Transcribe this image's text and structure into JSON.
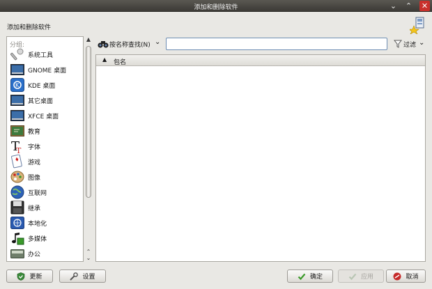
{
  "window": {
    "title": "添加和删除软件"
  },
  "header": {
    "label": "添加和删除软件"
  },
  "sidebar": {
    "group_label": "分组:",
    "items": [
      {
        "label": "系统工具",
        "icon": "system-tools-icon"
      },
      {
        "label": "GNOME 桌面",
        "icon": "gnome-desktop-icon"
      },
      {
        "label": "KDE 桌面",
        "icon": "kde-desktop-icon"
      },
      {
        "label": "其它桌面",
        "icon": "other-desktops-icon"
      },
      {
        "label": "XFCE 桌面",
        "icon": "xfce-desktop-icon"
      },
      {
        "label": "教育",
        "icon": "education-icon"
      },
      {
        "label": "字体",
        "icon": "fonts-icon"
      },
      {
        "label": "游戏",
        "icon": "games-icon"
      },
      {
        "label": "图像",
        "icon": "graphics-icon"
      },
      {
        "label": "互联网",
        "icon": "internet-icon"
      },
      {
        "label": "继承",
        "icon": "legacy-icon"
      },
      {
        "label": "本地化",
        "icon": "localization-icon"
      },
      {
        "label": "多媒体",
        "icon": "multimedia-icon"
      },
      {
        "label": "办公",
        "icon": "office-icon"
      }
    ]
  },
  "search": {
    "mode_label": "按名称查找(N)",
    "value": "",
    "filter_label": "过滤"
  },
  "package_list": {
    "column_header": "包名",
    "rows": []
  },
  "buttons": {
    "update": "更新",
    "settings": "设置",
    "ok": "确定",
    "apply": "应用",
    "cancel": "取消"
  },
  "colors": {
    "titlebar": "#4a4844",
    "close": "#c9302c",
    "ok_green": "#3a9a2a",
    "cancel_red": "#c62a2a"
  }
}
